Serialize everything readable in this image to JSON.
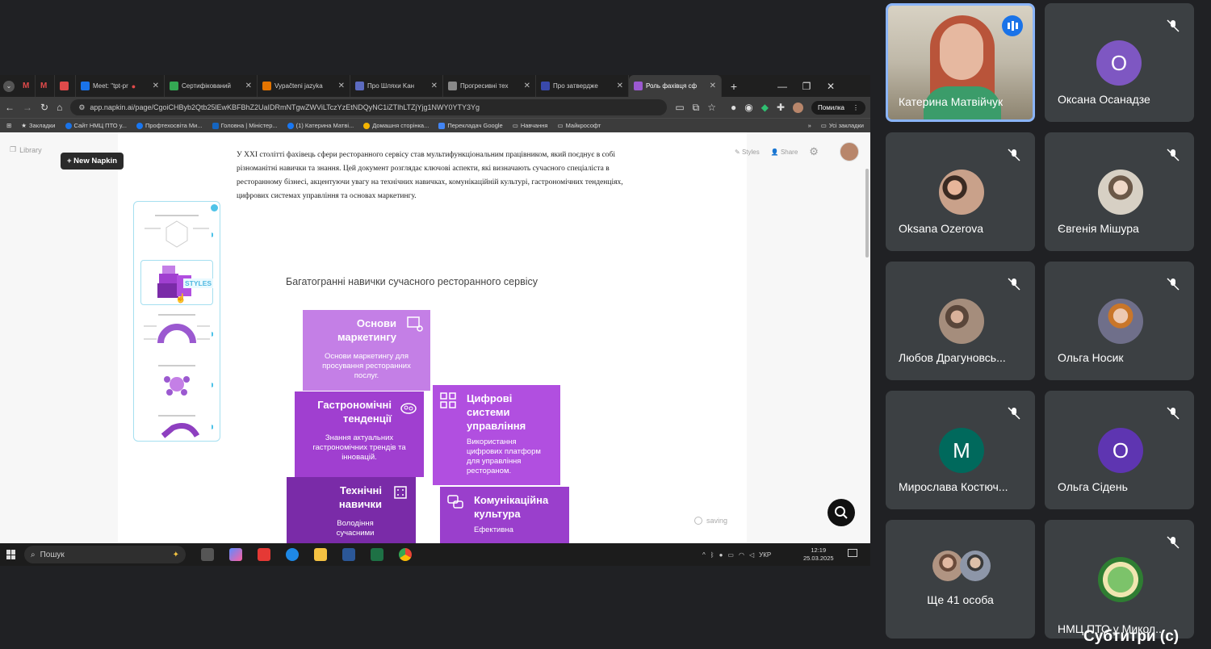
{
  "browser": {
    "tabs": [
      {
        "label": "",
        "color": "#d14836"
      },
      {
        "label": "",
        "color": "#d14836"
      },
      {
        "label": "",
        "color": "#e04a4a"
      },
      {
        "label": "Meet: \"tpt-pr",
        "color": "#1a73e8"
      },
      {
        "label": "Сертифікований",
        "color": "#34a853"
      },
      {
        "label": "Vypačteni jazyka",
        "color": "#e37400"
      },
      {
        "label": "Про Шляхи Kaн",
        "color": "#5c6bc0"
      },
      {
        "label": "Прогресивні тех",
        "color": "#888888"
      },
      {
        "label": "Про затвердже",
        "color": "#3949ab"
      },
      {
        "label": "Роль фахівця сф",
        "color": "#9b59d0",
        "active": true
      }
    ],
    "url": "app.napkin.ai/page/CgoiCHByb2Qtb25lEwKBFBhZ2UaIDRmNTgwZWViLTczYzEtNDQyNC1iZTlhLTZjYjg1NWY0YTY3Yg",
    "error_button": "Помилка",
    "bookmarks": [
      {
        "label": "Закладки",
        "color": "#e8eaed"
      },
      {
        "label": "Сайт НМЦ ПТО у...",
        "color": "#1a73e8"
      },
      {
        "label": "Профтехосвіта Ми...",
        "color": "#1877f2"
      },
      {
        "label": "Головна | Міністер...",
        "color": "#1565c0"
      },
      {
        "label": "(1) Катерина Матві...",
        "color": "#1877f2"
      },
      {
        "label": "Домашня сторінка...",
        "color": "#f4b400"
      },
      {
        "label": "Перекладач Google",
        "color": "#4285f4"
      },
      {
        "label": "Навчання",
        "color": "#ffffff"
      },
      {
        "label": "Майкрософт",
        "color": "#ffffff"
      }
    ],
    "all_bookmarks": "Усі закладки"
  },
  "napkin": {
    "library": "Library",
    "new_napkin": "+ New Napkin",
    "styles": "Styles",
    "share": "Share",
    "intro": "У XXI столітті фахівець сфери ресторанного сервісу став мультифункціональним працівником, який поєднує в собі різноманітні навички та знання. Цей документ розглядає ключові аспекти, які визначають сучасного спеціаліста в ресторанному бізнесі, акцентуючи увагу на технічних навичках, комунікаційній культурі, гастрономічних тенденціях, цифрових системах управління та основах маркетингу.",
    "diagram_title": "Багатогранні навички сучасного ресторанного сервісу",
    "thumb_label": "STYLES",
    "saving": "saving",
    "blocks": {
      "marketing": {
        "title": "Основи маркетингу",
        "desc": "Основи маркетингу для просування ресторанних послуг.",
        "color": "#c47fe6"
      },
      "gastro": {
        "title": "Гастрономічні тенденції",
        "desc": "Знання актуальних гастрономічних трендів та інновацій.",
        "color": "#a03fd0"
      },
      "digital": {
        "title": "Цифрові системи управління",
        "desc": "Використання цифрових платформ для управління рестораном.",
        "color": "#b14fe0"
      },
      "technical": {
        "title": "Технічні навички",
        "desc": "Володіння сучасними",
        "color": "#7a2ba8"
      },
      "communication": {
        "title": "Комунікаційна культура",
        "desc": "Ефективна",
        "color": "#9a3fcc"
      }
    }
  },
  "taskbar": {
    "search": "Пошук",
    "lang": "УКР",
    "time": "12:19",
    "date": "25.03.2025"
  },
  "participants": [
    {
      "name": "Катерина Матвійчук",
      "type": "video",
      "speaking": true
    },
    {
      "name": "Оксана Осанадзе",
      "type": "letter",
      "letter": "O",
      "color": "#7e57c2"
    },
    {
      "name": "Oksana Ozerova",
      "type": "photo"
    },
    {
      "name": "Євгенія Мішура",
      "type": "photo"
    },
    {
      "name": "Любов Драгуновсь...",
      "type": "photo"
    },
    {
      "name": "Ольга Носик",
      "type": "photo"
    },
    {
      "name": "Мирослава Костюч...",
      "type": "letter",
      "letter": "M",
      "color": "#00695c"
    },
    {
      "name": "Ольга Сідень",
      "type": "letter",
      "letter": "O",
      "color": "#5e35b1"
    },
    {
      "name": "Ще 41 особа",
      "type": "more"
    },
    {
      "name": "НМЦ ПТО у Микол...",
      "type": "photo"
    }
  ],
  "captions": "Субтитри (c)"
}
